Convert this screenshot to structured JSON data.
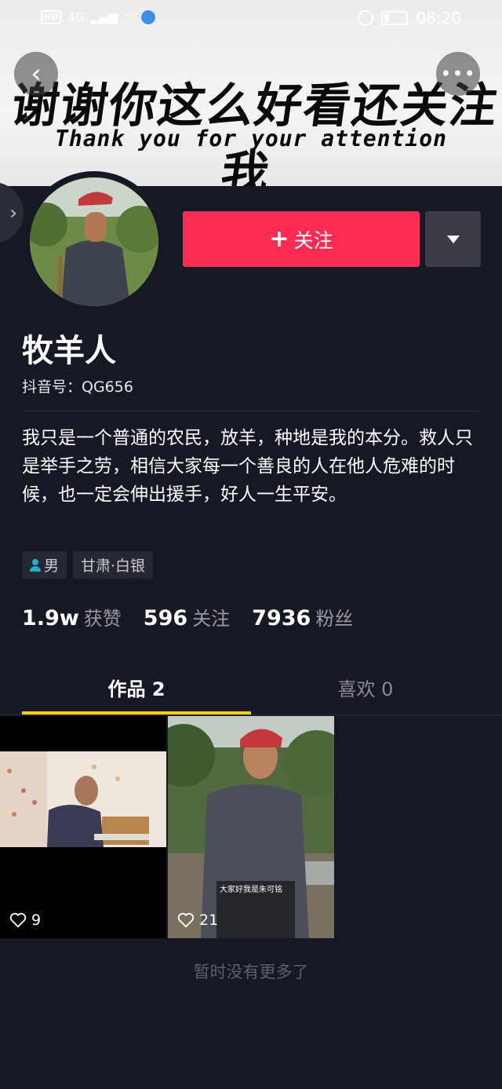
{
  "status_bar": {
    "left": {
      "hd": "HD",
      "network": "4G"
    },
    "time": "08:20"
  },
  "banner": {
    "title": "谢谢你这么好看还关注我",
    "subtitle": "Thank you for your attention"
  },
  "nav": {
    "back_glyph": "‹",
    "more_glyph": "•••",
    "side_glyph": "›"
  },
  "profile": {
    "follow_label": "关注",
    "follow_plus": "+",
    "nickname": "牧羊人",
    "douyin_id": "抖音号：QG656",
    "bio": "我只是一个普通的农民，放羊，种地是我的本分。救人只是举手之劳，相信大家每一个善良的人在他人危难的时候，也一定会伸出援手，好人一生平安。",
    "tags": {
      "gender": "男",
      "location": "甘肃·白银"
    },
    "stats": [
      {
        "value": "1.9w",
        "label": "获赞"
      },
      {
        "value": "596",
        "label": "关注"
      },
      {
        "value": "7936",
        "label": "粉丝"
      }
    ]
  },
  "tabs": [
    {
      "label": "作品 2",
      "active": true
    },
    {
      "label": "喜欢 0",
      "active": false
    }
  ],
  "videos": [
    {
      "likes": "9",
      "caption": ""
    },
    {
      "likes": "21",
      "caption": "大家好我是朱可铭"
    }
  ],
  "end_text": "暂时没有更多了",
  "colors": {
    "accent": "#fe2c55",
    "tab_indicator": "#face15",
    "background": "#161823"
  }
}
